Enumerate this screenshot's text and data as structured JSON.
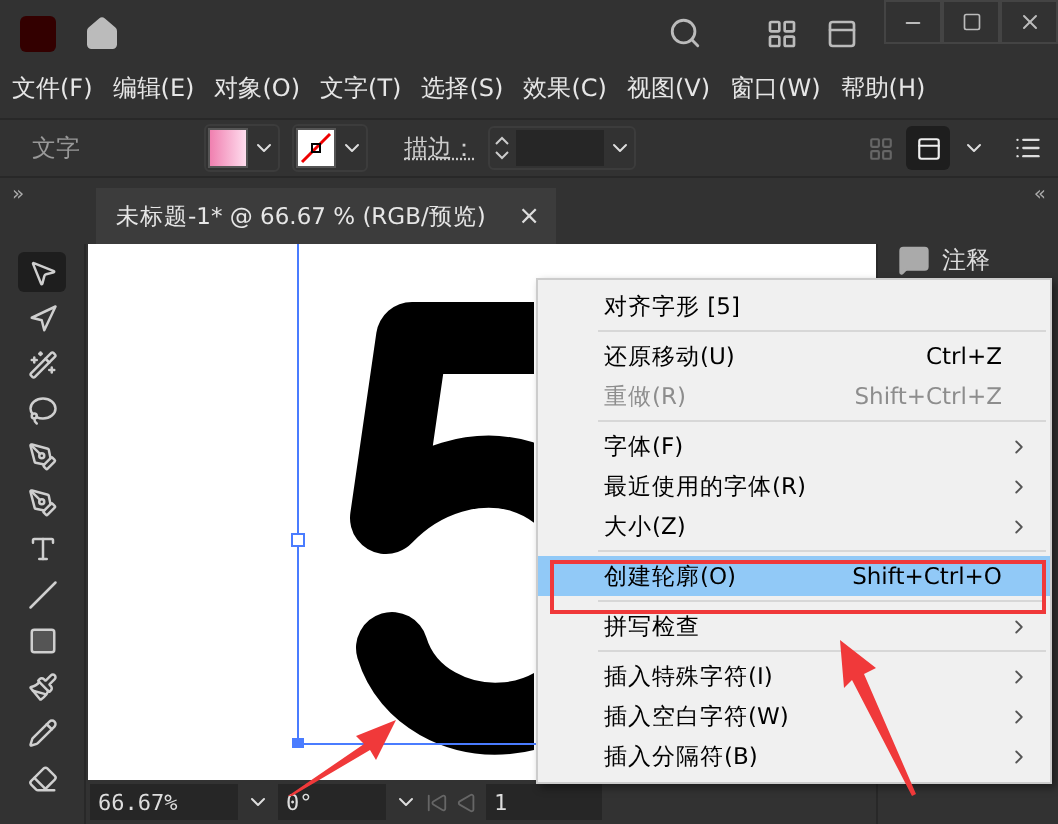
{
  "menu_bar": [
    "文件(F)",
    "编辑(E)",
    "对象(O)",
    "文字(T)",
    "选择(S)",
    "效果(C)",
    "视图(V)",
    "窗口(W)",
    "帮助(H)"
  ],
  "options_bar": {
    "label": "文字",
    "stroke_label": "描边："
  },
  "document_tab": {
    "title": "未标题-1* @ 66.67 % (RGB/预览)",
    "close": "×"
  },
  "panel_toggles": {
    "left": "»",
    "right": "«"
  },
  "tools": [
    {
      "kind": "select",
      "selected": true
    },
    {
      "kind": "direct",
      "selected": false
    },
    {
      "kind": "wand",
      "selected": false
    },
    {
      "kind": "lasso",
      "selected": false
    },
    {
      "kind": "pen",
      "selected": false
    },
    {
      "kind": "curvature",
      "selected": false
    },
    {
      "kind": "type",
      "selected": false
    },
    {
      "kind": "line",
      "selected": false
    },
    {
      "kind": "rect",
      "selected": false
    },
    {
      "kind": "brush",
      "selected": false
    },
    {
      "kind": "pencil",
      "selected": false
    },
    {
      "kind": "eraser",
      "selected": false
    }
  ],
  "right_panel": {
    "label": "注释"
  },
  "status_bar": {
    "zoom": "66.67%",
    "rotation": "0°",
    "page": "1"
  },
  "context_menu": [
    {
      "kind": "item",
      "label": "对齐字形 [5]",
      "disabled": false,
      "selected": false,
      "submenu": false
    },
    {
      "kind": "separator"
    },
    {
      "kind": "item",
      "label": "还原移动(U)",
      "shortcut": "Ctrl+Z",
      "disabled": false,
      "selected": false,
      "submenu": false
    },
    {
      "kind": "item",
      "label": "重做(R)",
      "shortcut": "Shift+Ctrl+Z",
      "disabled": true,
      "selected": false,
      "submenu": false
    },
    {
      "kind": "separator"
    },
    {
      "kind": "item",
      "label": "字体(F)",
      "disabled": false,
      "selected": false,
      "submenu": true
    },
    {
      "kind": "item",
      "label": "最近使用的字体(R)",
      "disabled": false,
      "selected": false,
      "submenu": true
    },
    {
      "kind": "item",
      "label": "大小(Z)",
      "disabled": false,
      "selected": false,
      "submenu": true
    },
    {
      "kind": "separator"
    },
    {
      "kind": "item",
      "label": "创建轮廓(O)",
      "shortcut": "Shift+Ctrl+O",
      "disabled": false,
      "selected": true,
      "submenu": false
    },
    {
      "kind": "separator"
    },
    {
      "kind": "item",
      "label": "拼写检查",
      "disabled": false,
      "selected": false,
      "submenu": true
    },
    {
      "kind": "separator"
    },
    {
      "kind": "item",
      "label": "插入特殊字符(I)",
      "disabled": false,
      "selected": false,
      "submenu": true
    },
    {
      "kind": "item",
      "label": "插入空白字符(W)",
      "disabled": false,
      "selected": false,
      "submenu": true
    },
    {
      "kind": "item",
      "label": "插入分隔符(B)",
      "disabled": false,
      "selected": false,
      "submenu": true
    }
  ]
}
